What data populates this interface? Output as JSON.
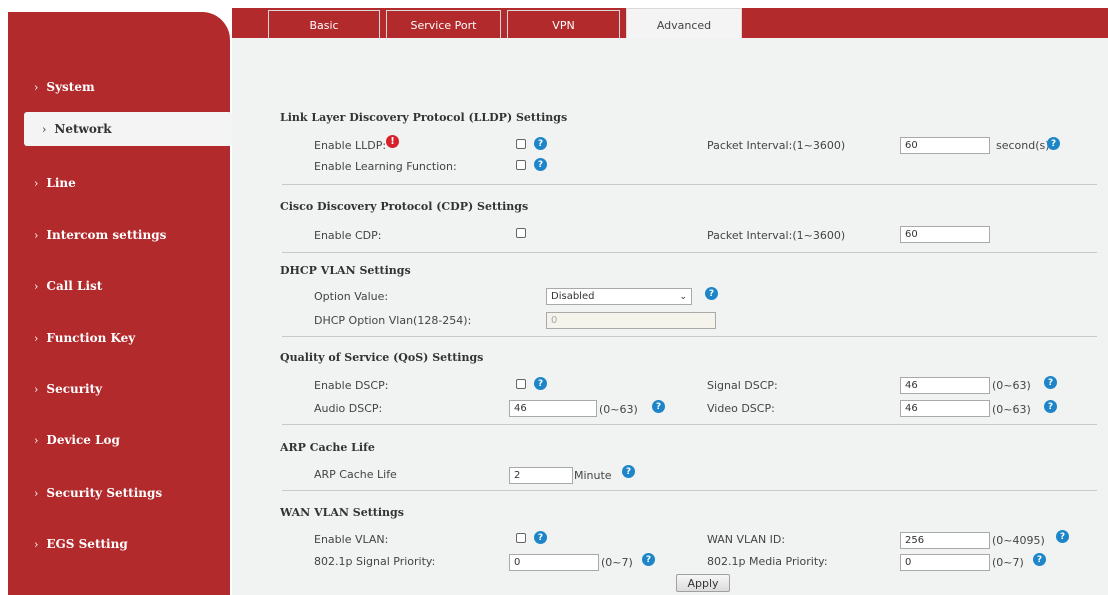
{
  "sidebar": {
    "items": [
      {
        "label": "System"
      },
      {
        "label": "Network"
      },
      {
        "label": "Line"
      },
      {
        "label": "Intercom settings"
      },
      {
        "label": "Call List"
      },
      {
        "label": "Function Key"
      },
      {
        "label": "Security"
      },
      {
        "label": "Device Log"
      },
      {
        "label": "Security Settings"
      },
      {
        "label": "EGS Setting"
      }
    ],
    "active": "Network"
  },
  "tabs": [
    {
      "label": "Basic"
    },
    {
      "label": "Service Port"
    },
    {
      "label": "VPN"
    },
    {
      "label": "Advanced"
    }
  ],
  "active_tab": "Advanced",
  "lldp": {
    "title": "Link Layer Discovery Protocol (LLDP) Settings",
    "enable_label": "Enable LLDP:",
    "learning_label": "Enable Learning Function:",
    "interval_label": "Packet Interval:(1~3600)",
    "interval_value": "60",
    "interval_unit": "second(s)"
  },
  "cdp": {
    "title": "Cisco Discovery Protocol (CDP) Settings",
    "enable_label": "Enable CDP:",
    "interval_label": "Packet Interval:(1~3600)",
    "interval_value": "60"
  },
  "dhcp_vlan": {
    "title": "DHCP VLAN Settings",
    "option_label": "Option Value:",
    "option_selected": "Disabled",
    "vlan_label": "DHCP Option Vlan(128-254):",
    "vlan_value": "0"
  },
  "qos": {
    "title": "Quality of Service (QoS) Settings",
    "enable_label": "Enable DSCP:",
    "signal_label": "Signal DSCP:",
    "signal_value": "46",
    "signal_range": "(0~63)",
    "audio_label": "Audio DSCP:",
    "audio_value": "46",
    "audio_range": "(0~63)",
    "video_label": "Video DSCP:",
    "video_value": "46",
    "video_range": "(0~63)"
  },
  "arp": {
    "title": "ARP Cache Life",
    "label": "ARP Cache Life",
    "value": "2",
    "unit": "Minute"
  },
  "wan_vlan": {
    "title": "WAN VLAN Settings",
    "enable_label": "Enable VLAN:",
    "id_label": "WAN VLAN ID:",
    "id_value": "256",
    "id_range": "(0~4095)",
    "signal_priority_label": "802.1p Signal Priority:",
    "signal_priority_value": "0",
    "signal_priority_range": "(0~7)",
    "media_priority_label": "802.1p Media Priority:",
    "media_priority_value": "0",
    "media_priority_range": "(0~7)"
  },
  "apply_label": "Apply",
  "colors": {
    "brand": "#b22a2c",
    "help": "#1e86c8",
    "warn": "#d8202a"
  }
}
